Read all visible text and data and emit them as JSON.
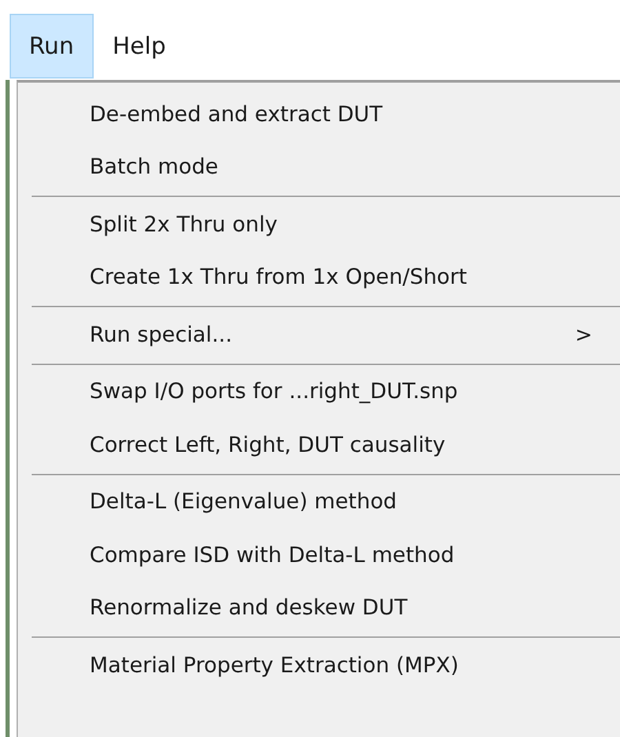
{
  "menu_bar": [
    {
      "label": "Run",
      "selected": true
    },
    {
      "label": "Help",
      "selected": false
    }
  ],
  "menu": {
    "groups": [
      [
        {
          "label": "De-embed and extract DUT"
        },
        {
          "label": "Batch mode"
        }
      ],
      [
        {
          "label": "Split 2x Thru only"
        },
        {
          "label": "Create 1x Thru from 1x Open/Short"
        }
      ],
      [
        {
          "label": "Run special...",
          "submenu_arrow": ">"
        }
      ],
      [
        {
          "label": "Swap I/O ports for ...right_DUT.snp"
        },
        {
          "label": "Correct Left, Right, DUT causality"
        }
      ],
      [
        {
          "label": "Delta-L (Eigenvalue) method"
        },
        {
          "label": "Compare ISD with Delta-L method"
        },
        {
          "label": "Renormalize and deskew DUT"
        }
      ],
      [
        {
          "label": "Material Property Extraction (MPX)"
        }
      ]
    ]
  }
}
